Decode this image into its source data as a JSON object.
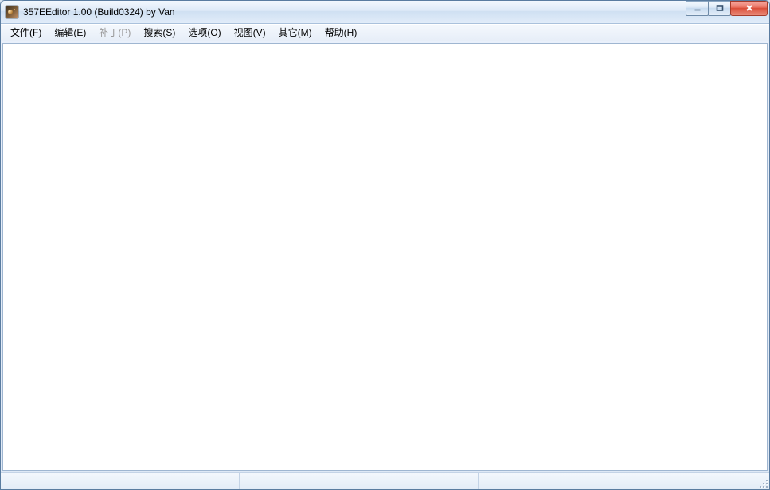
{
  "window": {
    "title": "357EEditor 1.00 (Build0324) by Van"
  },
  "menu": {
    "items": [
      {
        "label": "文件(F)",
        "enabled": true
      },
      {
        "label": "编辑(E)",
        "enabled": true
      },
      {
        "label": "补丁(P)",
        "enabled": false
      },
      {
        "label": "搜索(S)",
        "enabled": true
      },
      {
        "label": "选项(O)",
        "enabled": true
      },
      {
        "label": "视图(V)",
        "enabled": true
      },
      {
        "label": "其它(M)",
        "enabled": true
      },
      {
        "label": "帮助(H)",
        "enabled": true
      }
    ]
  },
  "status": {
    "pane1": "",
    "pane2": "",
    "pane3": ""
  },
  "icons": {
    "app": "app-icon",
    "minimize": "minimize-icon",
    "maximize": "maximize-icon",
    "close": "close-icon",
    "size_grip": "size-grip-icon"
  }
}
